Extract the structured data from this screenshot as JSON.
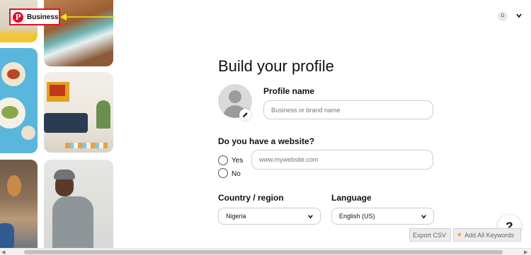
{
  "header": {
    "logo_text": "Business",
    "account_initial": "D"
  },
  "main": {
    "title": "Build your profile",
    "profile_name_label": "Profile name",
    "profile_name_placeholder": "Business or brand name",
    "website_question": "Do you have a website?",
    "radio_yes": "Yes",
    "radio_no": "No",
    "website_placeholder": "www.mywebsite.com",
    "country_label": "Country / region",
    "country_value": "Nigeria",
    "language_label": "Language",
    "language_value": "English (US)"
  },
  "help_label": "?",
  "extension": {
    "export_label": "Export CSV",
    "add_all_label": "Add All Keywords"
  },
  "colors": {
    "brand": "#e60023",
    "annotation_box": "#e0121c",
    "annotation_arrow": "#f5e614"
  },
  "icons": [
    "pinterest-logo-icon",
    "arrow-annotation-icon",
    "chevron-down-icon",
    "pencil-icon",
    "star-icon"
  ]
}
